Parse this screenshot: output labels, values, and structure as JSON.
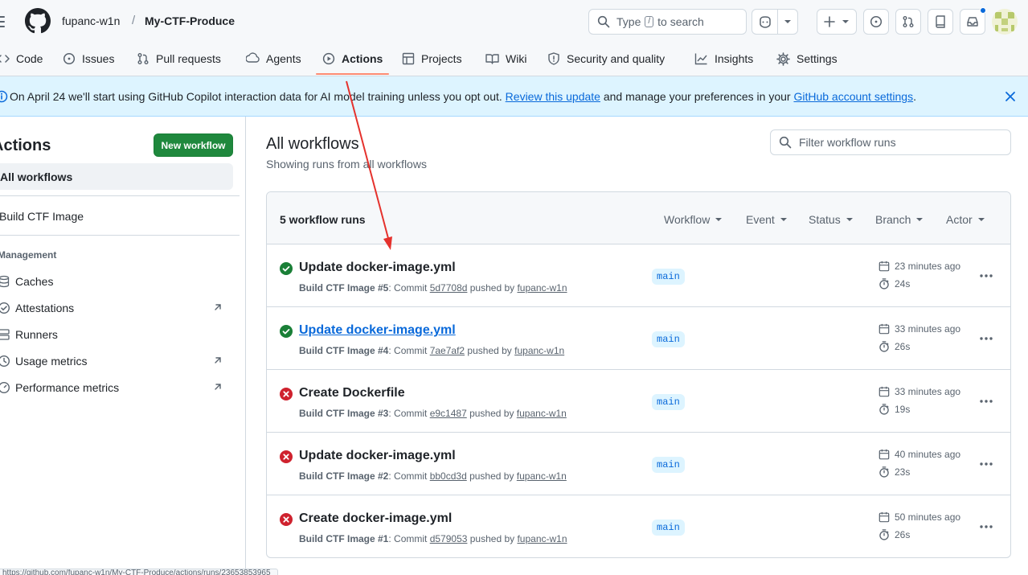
{
  "header": {
    "owner": "fupanc-w1n",
    "separator": "/",
    "repo": "My-CTF-Produce",
    "search": {
      "prefix": "Type",
      "key": "/",
      "suffix": "to search"
    },
    "avatar_icon": "identicon-avatar"
  },
  "nav": {
    "tabs": [
      {
        "label": "Code",
        "icon": "code-icon"
      },
      {
        "label": "Issues",
        "icon": "issue-opened-icon"
      },
      {
        "label": "Pull requests",
        "icon": "git-pull-request-icon"
      },
      {
        "label": "Agents",
        "icon": "agent-icon"
      },
      {
        "label": "Actions",
        "icon": "play-icon",
        "active": true
      },
      {
        "label": "Projects",
        "icon": "table-icon"
      },
      {
        "label": "Wiki",
        "icon": "book-icon"
      },
      {
        "label": "Security and quality",
        "icon": "shield-icon"
      },
      {
        "label": "Insights",
        "icon": "graph-icon"
      },
      {
        "label": "Settings",
        "icon": "gear-icon"
      }
    ],
    "accent": "#fd8c73"
  },
  "banner": {
    "text_before": "On April 24 we'll start using GitHub Copilot interaction data for AI model training unless you opt out. ",
    "link1": "Review this update",
    "text_middle": " and manage your preferences in your ",
    "link2": "GitHub account settings",
    "text_after": "."
  },
  "sidebar": {
    "title": "Actions",
    "new_workflow": "New workflow",
    "all_workflows": "All workflows",
    "workflow": "Build CTF Image",
    "management_heading": "Management",
    "management_items": [
      {
        "label": "Caches",
        "external": false
      },
      {
        "label": "Attestations",
        "external": true
      },
      {
        "label": "Runners",
        "external": false
      },
      {
        "label": "Usage metrics",
        "external": true
      },
      {
        "label": "Performance metrics",
        "external": true
      }
    ]
  },
  "main": {
    "title": "All workflows",
    "subtitle": "Showing runs from all workflows",
    "filter_placeholder": "Filter workflow runs",
    "runs_count": "5 workflow runs",
    "filters": [
      "Workflow",
      "Event",
      "Status",
      "Branch",
      "Actor"
    ],
    "runs": [
      {
        "status": "success",
        "title": "Update docker-image.yml",
        "workflow": "Build CTF Image #5",
        "commit": "5d7708d",
        "author": "fupanc-w1n",
        "branch": "main",
        "time": "23 minutes ago",
        "duration": "24s"
      },
      {
        "status": "success",
        "title": "Update docker-image.yml",
        "workflow": "Build CTF Image #4",
        "commit": "7ae7af2",
        "author": "fupanc-w1n",
        "branch": "main",
        "time": "33 minutes ago",
        "duration": "26s",
        "hovered": true
      },
      {
        "status": "failure",
        "title": "Create Dockerfile",
        "workflow": "Build CTF Image #3",
        "commit": "e9c1487",
        "author": "fupanc-w1n",
        "branch": "main",
        "time": "33 minutes ago",
        "duration": "19s"
      },
      {
        "status": "failure",
        "title": "Update docker-image.yml",
        "workflow": "Build CTF Image #2",
        "commit": "bb0cd3d",
        "author": "fupanc-w1n",
        "branch": "main",
        "time": "40 minutes ago",
        "duration": "23s"
      },
      {
        "status": "failure",
        "title": "Create docker-image.yml",
        "workflow": "Build CTF Image #1",
        "commit": "d579053",
        "author": "fupanc-w1n",
        "branch": "main",
        "time": "50 minutes ago",
        "duration": "26s"
      }
    ],
    "meta_commit_label": ": Commit ",
    "meta_pushed_label": " pushed by "
  },
  "colors": {
    "success": "#1a7f37",
    "failure": "#cf222e",
    "link": "#0969da",
    "primary_button": "#1f883d",
    "annotation_arrow": "#e5322d"
  },
  "status_bar": {
    "url": "https://github.com/fupanc-w1n/My-CTF-Produce/actions/runs/23653853965"
  }
}
